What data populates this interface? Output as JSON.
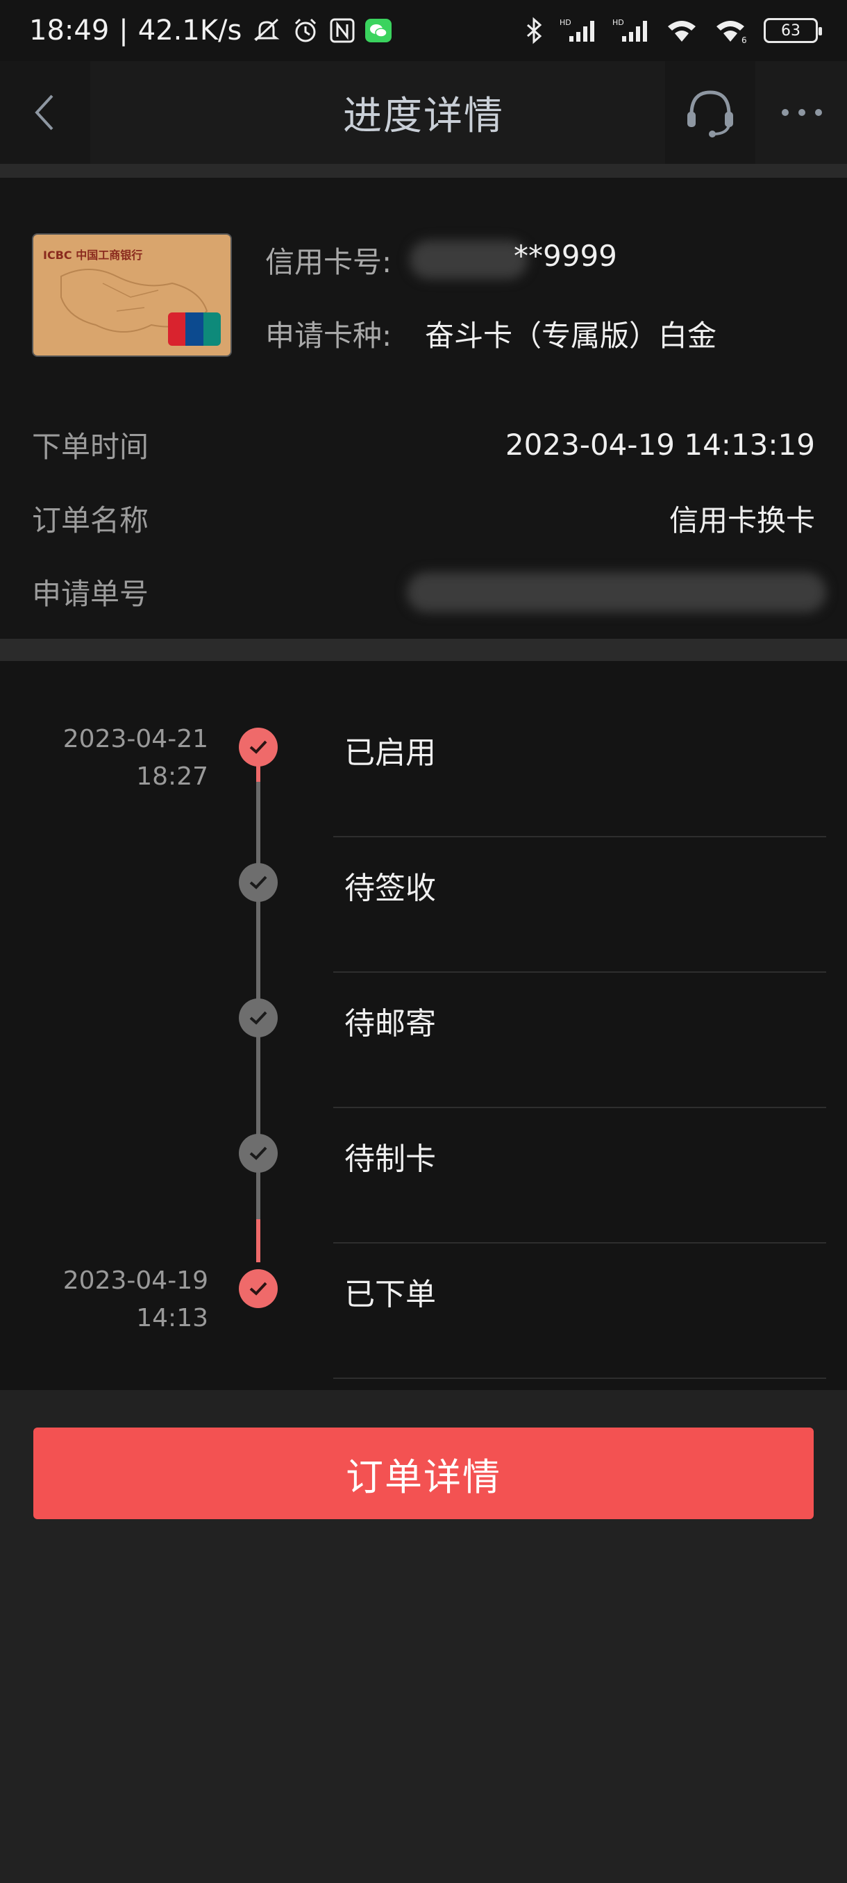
{
  "status_bar": {
    "time": "18:49",
    "network_speed": "42.1K/s",
    "battery": "63",
    "icons_left": [
      "mute-icon",
      "alarm-icon",
      "nfc-icon",
      "wechat-icon"
    ],
    "icons_right": [
      "bluetooth-icon",
      "signal-hd-icon",
      "signal-hd-icon",
      "wifi-icon",
      "hotspot-icon",
      "battery-icon"
    ]
  },
  "nav": {
    "title": "进度详情",
    "back_icon": "chevron-left-icon",
    "service_icon": "headset-icon",
    "more_icon": "more-icon"
  },
  "card": {
    "card_number_label": "信用卡号:",
    "card_number_value": "**9999",
    "card_type_label": "申请卡种:",
    "card_type_value": "奋斗卡（专属版）白金",
    "image_bank_text": "ICBC 中国工商银行"
  },
  "order": {
    "time_label": "下单时间",
    "time_value": "2023-04-19 14:13:19",
    "name_label": "订单名称",
    "name_value": "信用卡换卡",
    "number_label": "申请单号"
  },
  "timeline": {
    "steps": [
      {
        "label": "已启用",
        "date": "2023-04-21",
        "time": "18:27",
        "status": "done"
      },
      {
        "label": "待签收",
        "date": "",
        "time": "",
        "status": "pending"
      },
      {
        "label": "待邮寄",
        "date": "",
        "time": "",
        "status": "pending"
      },
      {
        "label": "待制卡",
        "date": "",
        "time": "",
        "status": "pending"
      },
      {
        "label": "已下单",
        "date": "2023-04-19",
        "time": "14:13",
        "status": "done"
      }
    ]
  },
  "actions": {
    "order_detail_label": "订单详情"
  },
  "colors": {
    "accent": "#f35252",
    "active_dot": "#ef6a6a",
    "inactive_dot": "#6e6e6e",
    "background": "#222222"
  }
}
